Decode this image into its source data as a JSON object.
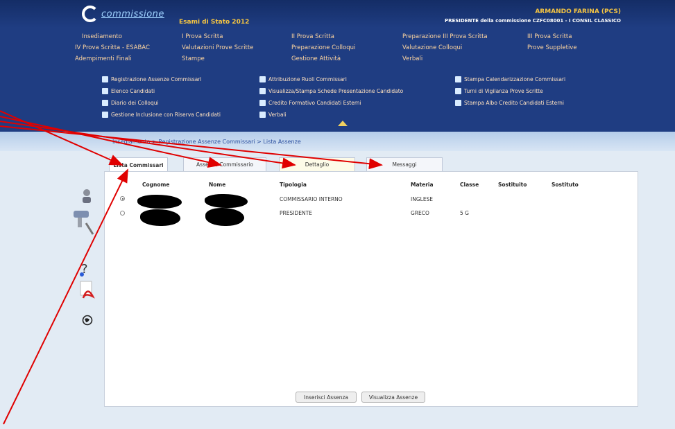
{
  "header": {
    "logo_text": "commissione",
    "exam_title": "Esami di Stato 2012",
    "user_name": "ARMANDO FARINA (PCS)",
    "user_role": "PRESIDENTE della commissione CZFC08001 - I CONSIL CLASSICO"
  },
  "menu": {
    "row1": [
      "Insediamento",
      "I Prova Scritta",
      "II Prova Scritta",
      "Preparazione III Prova Scritta",
      "III Prova Scritta"
    ],
    "row2": [
      "IV Prova Scritta - ESABAC",
      "Valutazioni Prove Scritte",
      "Preparazione Colloqui",
      "Valutazione Colloqui",
      "Prove Suppletive"
    ],
    "row3": [
      "Adempimenti Finali",
      "Stampe",
      "Gestione Attività",
      "Verbali"
    ]
  },
  "submenu": {
    "col1": [
      "Registrazione Assenze Commissari",
      "Elenco Candidati",
      "Diario dei Colloqui",
      "Gestione Inclusione con Riserva Candidati"
    ],
    "col2": [
      "Attribuzione Ruoli Commissari",
      "Visualizza/Stampa Schede Presentazione Candidato",
      "Credito Formativo Candidati Esterni",
      "Verbali"
    ],
    "col3": [
      "Stampa Calendarizzazione Commissari",
      "Turni di Vigilanza Prove Scritte",
      "Stampa Albo Credito Candidati Esterni"
    ]
  },
  "breadcrumb": "Insediamento > Registrazione Assenze Commissari > Lista Assenze",
  "tabs": [
    "Lista Commissari",
    "Assenze Commissario",
    "Dettaglio",
    "Messaggi"
  ],
  "table": {
    "headers": [
      "Cognome",
      "Nome",
      "Tipologia",
      "Materia",
      "Classe",
      "Sostituito",
      "Sostituto"
    ],
    "rows": [
      {
        "tipologia": "COMMISSARIO INTERNO",
        "materia": "INGLESE",
        "classe": "",
        "selected": true
      },
      {
        "tipologia": "PRESIDENTE",
        "materia": "GRECO",
        "classe": "5 G",
        "selected": false
      }
    ]
  },
  "buttons": {
    "insert": "Inserisci Assenza",
    "view": "Visualizza Assenze"
  },
  "colors": {
    "header_bg": "#1f3d82",
    "menu_text": "#ffd6a0",
    "accent": "#f5c542",
    "annotation": "#e00000"
  },
  "icons": [
    "user-icon",
    "tools-icon",
    "help-icon",
    "pdf-icon",
    "globe-icon"
  ]
}
